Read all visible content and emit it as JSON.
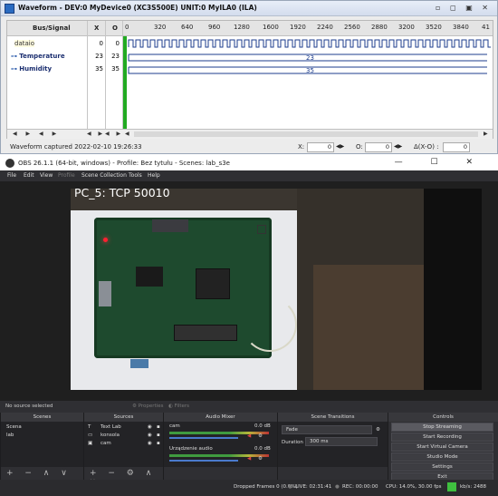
{
  "waveform": {
    "title": "Waveform - DEV:0 MyDevice0 (XC3S500E) UNIT:0 MyILA0 (ILA)",
    "window_buttons": "▫ ◻ ▣ ✕",
    "headers": {
      "bus_signal": "Bus/Signal",
      "x": "X",
      "o": "O"
    },
    "ticks": [
      "0",
      "320",
      "640",
      "960",
      "1280",
      "1600",
      "1920",
      "2240",
      "2560",
      "2880",
      "3200",
      "3520",
      "3840",
      "41"
    ],
    "rows": [
      {
        "name": "dataio",
        "x": "0",
        "o": "0",
        "value": ""
      },
      {
        "name": "Temperature",
        "x": "23",
        "o": "23",
        "value": "23"
      },
      {
        "name": "Humidity",
        "x": "35",
        "o": "35",
        "value": "35"
      }
    ],
    "status": "Waveform captured 2022-02-10 19:26:33",
    "x_label": "X:",
    "x_value": "0",
    "o_label": "O:",
    "o_value": "0",
    "delta_label": "Δ(X-O) :",
    "delta_value": "0"
  },
  "obs": {
    "title": "OBS 26.1.1 (64-bit, windows) - Profile: Bez tytułu - Scenes: lab_s3e",
    "window_buttons": "— ☐ ✕",
    "menu": [
      "File",
      "Edit",
      "View",
      "Profile",
      "Scene Collection",
      "Tools",
      "Help"
    ],
    "preview_label": "PC_5: TCP 50010",
    "no_source": "No source selected",
    "properties": "Properties",
    "filters": "Filters",
    "docks": {
      "scenes": {
        "title": "Scenes",
        "items": [
          "Scena",
          "lab"
        ]
      },
      "sources": {
        "title": "Sources",
        "items": [
          "Text Lab",
          "konsola",
          "cam"
        ]
      },
      "mixer": {
        "title": "Audio Mixer",
        "channels": [
          {
            "name": "cam",
            "db": "0.0 dB"
          },
          {
            "name": "Urządzenie audio",
            "db": "0.0 dB"
          }
        ]
      },
      "transitions": {
        "title": "Scene Transitions",
        "type": "Fade",
        "duration_label": "Duration",
        "duration_value": "300 ms"
      },
      "controls": {
        "title": "Controls",
        "buttons": [
          "Stop Streaming",
          "Start Recording",
          "Start Virtual Camera",
          "Studio Mode",
          "Settings",
          "Exit"
        ]
      }
    },
    "status": {
      "dropped": "Dropped Frames 0 (0.0%)",
      "live": "LIVE: 02:31:41",
      "rec": "REC: 00:00:00",
      "cpu": "CPU: 14.0%, 30.00 fps",
      "kbps": "kb/s: 2488"
    },
    "colors": {
      "accent_green": "#3fbf3f"
    }
  }
}
